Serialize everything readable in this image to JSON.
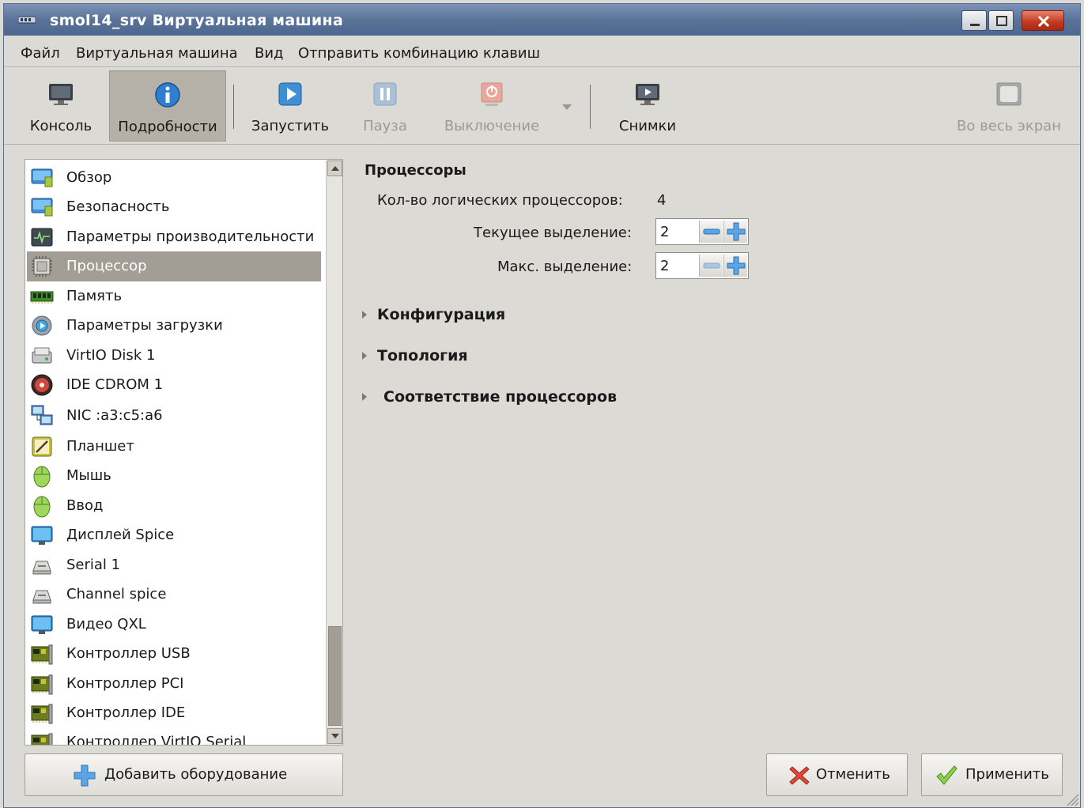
{
  "window": {
    "title": "smol14_srv Виртуальная машина"
  },
  "menu": [
    "Файл",
    "Виртуальная машина",
    "Вид",
    "Отправить комбинацию клавиш"
  ],
  "toolbar": {
    "console": "Консоль",
    "details": "Подробности",
    "run": "Запустить",
    "pause": "Пауза",
    "shutdown": "Выключение",
    "snapshots": "Снимки",
    "fullscreen": "Во весь экран"
  },
  "devices": [
    {
      "label": "Обзор",
      "icon": "monitor-icon"
    },
    {
      "label": "Безопасность",
      "icon": "monitor-icon"
    },
    {
      "label": "Параметры производительности",
      "icon": "performance-icon"
    },
    {
      "label": "Процессор",
      "icon": "cpu-icon"
    },
    {
      "label": "Память",
      "icon": "memory-icon"
    },
    {
      "label": "Параметры загрузки",
      "icon": "boot-gear-icon"
    },
    {
      "label": "VirtIO Disk 1",
      "icon": "disk-icon"
    },
    {
      "label": "IDE CDROM 1",
      "icon": "cdrom-icon"
    },
    {
      "label": "NIC :a3:c5:a6",
      "icon": "network-icon"
    },
    {
      "label": "Планшет",
      "icon": "tablet-icon"
    },
    {
      "label": "Мышь",
      "icon": "mouse-icon"
    },
    {
      "label": "Ввод",
      "icon": "mouse-icon"
    },
    {
      "label": "Дисплей Spice",
      "icon": "display-icon"
    },
    {
      "label": "Serial 1",
      "icon": "serial-icon"
    },
    {
      "label": "Channel spice",
      "icon": "serial-icon"
    },
    {
      "label": "Видео QXL",
      "icon": "display-icon"
    },
    {
      "label": "Контроллер USB",
      "icon": "controller-card-icon"
    },
    {
      "label": "Контроллер PCI",
      "icon": "controller-card-icon"
    },
    {
      "label": "Контроллер IDE",
      "icon": "controller-card-icon"
    },
    {
      "label": "Контроллер VirtIO Serial",
      "icon": "controller-card-icon"
    }
  ],
  "selected_device": "Процессор",
  "add_hardware": "Добавить оборудование",
  "cpu": {
    "title": "Процессоры",
    "logical_label": "Кол-во логических процессоров:",
    "logical_value": "4",
    "current_label": "Текущее выделение:",
    "current_value": "2",
    "max_label": "Макс. выделение:",
    "max_value": "2"
  },
  "expanders": {
    "config": "Конфигурация",
    "topology": "Топология",
    "pinning": "Соответствие процессоров"
  },
  "buttons": {
    "cancel": "Отменить",
    "apply": "Применить"
  }
}
